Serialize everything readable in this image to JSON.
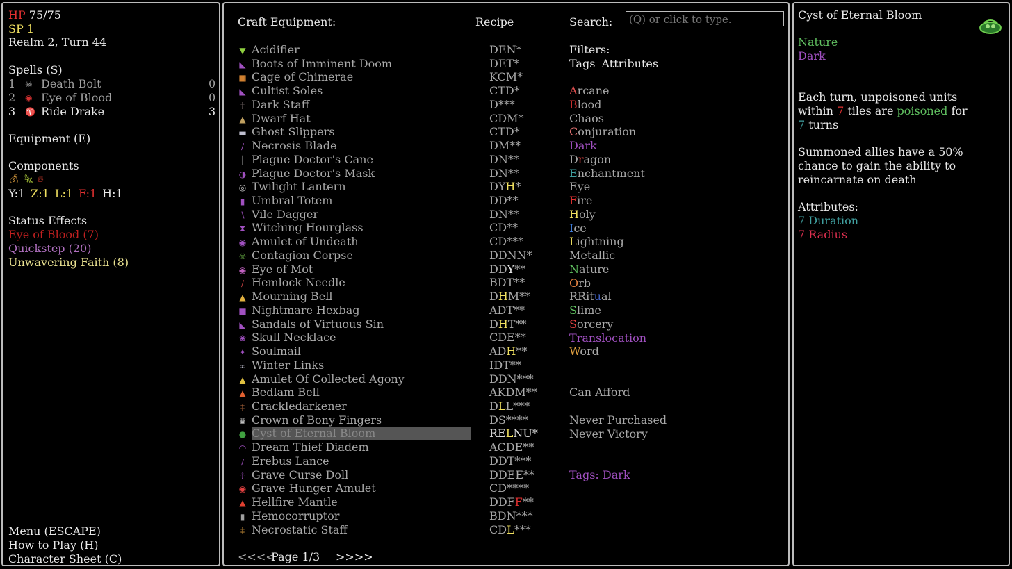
{
  "left": {
    "hp_label": "HP",
    "hp_value": "75/75",
    "sp_label": "SP",
    "sp_value": "1",
    "realm_turn": "Realm 2, Turn 44",
    "spells_header": "Spells (S)",
    "spells": [
      {
        "num": "1",
        "name": "Death Bolt",
        "charges": "0",
        "icon": "skull-bolt-icon",
        "color": "#a0a0a0"
      },
      {
        "num": "2",
        "name": "Eye of Blood",
        "charges": "0",
        "icon": "blood-eye-icon",
        "color": "#a0a0a0"
      },
      {
        "num": "3",
        "name": "Ride Drake",
        "charges": "3",
        "icon": "drake-icon",
        "color": "#e8e8e8"
      }
    ],
    "equipment_header": "Equipment (E)",
    "components_header": "Components",
    "components_counts": [
      {
        "label": "Y:1",
        "color": "#e8e8e8"
      },
      {
        "label": "Z:1",
        "color": "#f0e060"
      },
      {
        "label": "L:1",
        "color": "#f0e060"
      },
      {
        "label": "F:1",
        "color": "#e03030"
      },
      {
        "label": "H:1",
        "color": "#e8e8e8"
      }
    ],
    "status_header": "Status Effects",
    "status_effects": [
      {
        "text": "Eye of Blood (7)",
        "color": "#c02020"
      },
      {
        "text": "Quickstep (20)",
        "color": "#b070c0"
      },
      {
        "text": "Unwavering Faith (8)",
        "color": "#e8e090"
      }
    ],
    "menu": "Menu (ESCAPE)",
    "how_to_play": "How to Play (H)",
    "character_sheet": "Character Sheet (C)"
  },
  "mid": {
    "title": "Craft Equipment:",
    "recipe_header": "Recipe",
    "search_label": "Search:",
    "search_placeholder": "(Q) or click to type.",
    "items": [
      {
        "name": "Acidifier",
        "recipe": "DEN*",
        "icon": "acid-icon",
        "icolor": "#8fd040"
      },
      {
        "name": "Boots of Imminent Doom",
        "recipe": "DET*",
        "icon": "boots-icon",
        "icolor": "#a050c0"
      },
      {
        "name": "Cage of Chimerae",
        "recipe": "KCM*",
        "icon": "cage-icon",
        "icolor": "#d08030"
      },
      {
        "name": "Cultist Soles",
        "recipe": "CTD*",
        "icon": "soles-icon",
        "icolor": "#a050c0"
      },
      {
        "name": "Dark Staff",
        "recipe": "D***",
        "icon": "staff-icon",
        "icolor": "#908080"
      },
      {
        "name": "Dwarf Hat",
        "recipe": "CDM*",
        "icon": "hat-icon",
        "icolor": "#c0a060"
      },
      {
        "name": "Ghost Slippers",
        "recipe": "CTD*",
        "icon": "slippers-icon",
        "icolor": "#c0c0d0"
      },
      {
        "name": "Necrosis Blade",
        "recipe": "DM**",
        "icon": "blade-icon",
        "icolor": "#a050c0"
      },
      {
        "name": "Plague Doctor's Cane",
        "recipe": "DN**",
        "icon": "cane-icon",
        "icolor": "#a0a0a0"
      },
      {
        "name": "Plague Doctor's Mask",
        "recipe": "DN**",
        "icon": "mask-icon",
        "icolor": "#a050c0"
      },
      {
        "name": "Twilight Lantern",
        "recipe": "DYH*",
        "icon": "lantern-icon",
        "icolor": "#c0c0c0",
        "hl": {
          "ch": "H",
          "color": "#f0e060"
        }
      },
      {
        "name": "Umbral Totem",
        "recipe": "DD**",
        "icon": "totem-icon",
        "icolor": "#a050c0"
      },
      {
        "name": "Vile Dagger",
        "recipe": "DN**",
        "icon": "dagger-icon",
        "icolor": "#a050c0"
      },
      {
        "name": "Witching Hourglass",
        "recipe": "CD**",
        "icon": "hourglass-icon",
        "icolor": "#a050c0"
      },
      {
        "name": "Amulet of Undeath",
        "recipe": "CD***",
        "icon": "amulet-icon",
        "icolor": "#a050c0"
      },
      {
        "name": "Contagion Corpse",
        "recipe": "DDNN*",
        "icon": "corpse-icon",
        "icolor": "#60a040"
      },
      {
        "name": "Eye of Mot",
        "recipe": "DDY**",
        "icon": "eye-icon",
        "icolor": "#c060c0",
        "hl": {
          "ch": "Y",
          "color": "#e8e8e8"
        }
      },
      {
        "name": "Hemlock Needle",
        "recipe": "BDT**",
        "icon": "needle-icon",
        "icolor": "#c04040"
      },
      {
        "name": "Mourning Bell",
        "recipe": "DHM**",
        "icon": "bell-icon",
        "icolor": "#e0b040",
        "hl": {
          "ch": "H",
          "color": "#f0e060"
        }
      },
      {
        "name": "Nightmare Hexbag",
        "recipe": "ADT**",
        "icon": "hexbag-icon",
        "icolor": "#a050c0"
      },
      {
        "name": "Sandals of Virtuous Sin",
        "recipe": "DHT**",
        "icon": "sandals-icon",
        "icolor": "#a050c0",
        "hl": {
          "ch": "H",
          "color": "#f0e060"
        }
      },
      {
        "name": "Skull Necklace",
        "recipe": "CDE**",
        "icon": "necklace-icon",
        "icolor": "#a050c0"
      },
      {
        "name": "Soulmail",
        "recipe": "ADH**",
        "icon": "soulmail-icon",
        "icolor": "#a050c0",
        "hl": {
          "ch": "H",
          "color": "#f0e060"
        }
      },
      {
        "name": "Winter Links",
        "recipe": "IDT**",
        "icon": "links-icon",
        "icolor": "#c0c0d0"
      },
      {
        "name": "Amulet Of Collected Agony",
        "recipe": "DDN***",
        "icon": "agony-amulet-icon",
        "icolor": "#e0c040"
      },
      {
        "name": "Bedlam Bell",
        "recipe": "AKDM**",
        "icon": "bedlam-bell-icon",
        "icolor": "#e06030"
      },
      {
        "name": "Crackledarkener",
        "recipe": "DLL***",
        "icon": "crackle-icon",
        "icolor": "#c07040",
        "hl": {
          "ch": "L",
          "color": "#f0e060"
        }
      },
      {
        "name": "Crown of Bony Fingers",
        "recipe": "DS****",
        "icon": "crown-icon",
        "icolor": "#c0c0c0"
      },
      {
        "name": "Cyst of Eternal Bloom",
        "recipe": "RELNU*",
        "icon": "cyst-icon",
        "icolor": "#40a040",
        "selected": true,
        "hl": {
          "ch": "L",
          "color": "#f0e060"
        }
      },
      {
        "name": "Dream Thief Diadem",
        "recipe": "ACDE**",
        "icon": "diadem-icon",
        "icolor": "#a050c0"
      },
      {
        "name": "Erebus Lance",
        "recipe": "DDT***",
        "icon": "lance-icon",
        "icolor": "#a050c0"
      },
      {
        "name": "Grave Curse Doll",
        "recipe": "DDEE**",
        "icon": "doll-icon",
        "icolor": "#a050c0"
      },
      {
        "name": "Grave Hunger Amulet",
        "recipe": "CD****",
        "icon": "hunger-amulet-icon",
        "icolor": "#e04040"
      },
      {
        "name": "Hellfire Mantle",
        "recipe": "DDFF**",
        "icon": "mantle-icon",
        "icolor": "#e04030",
        "hl": {
          "ch": "F",
          "color": "#e03030",
          "idx": 3
        }
      },
      {
        "name": "Hemocorruptor",
        "recipe": "BDN***",
        "icon": "hemo-icon",
        "icolor": "#a0a0a0"
      },
      {
        "name": "Necrostatic Staff",
        "recipe": "CDL***",
        "icon": "necro-staff-icon",
        "icolor": "#e0a040",
        "hl": {
          "ch": "L",
          "color": "#f0e060"
        }
      }
    ],
    "filters_header": "Filters:",
    "filter_tabs": [
      "Tags",
      "Attributes"
    ],
    "tags": [
      {
        "name": "Arcane",
        "color": "#e05050"
      },
      {
        "name": "Blood",
        "color": "#d03030"
      },
      {
        "name": "Chaos",
        "color": "#a8a8a8"
      },
      {
        "name": "Conjuration",
        "color": "#e07070"
      },
      {
        "name": "Dark",
        "color": "#a050c0"
      },
      {
        "name": "Dragon",
        "color": "#e04040"
      },
      {
        "name": "Enchantment",
        "color": "#40a0a0"
      },
      {
        "name": "Eye",
        "color": "#e8e8e8"
      },
      {
        "name": "Fire",
        "color": "#e03030"
      },
      {
        "name": "Holy",
        "color": "#f0e060"
      },
      {
        "name": "Ice",
        "color": "#4080e0"
      },
      {
        "name": "Lightning",
        "color": "#f0e060"
      },
      {
        "name": "Metallic",
        "color": "#a8a8a8"
      },
      {
        "name": "Nature",
        "color": "#60c060"
      },
      {
        "name": "Orb",
        "color": "#e08040"
      },
      {
        "name": "Ritual",
        "color": "#4060c0"
      },
      {
        "name": "Slime",
        "color": "#60c060"
      },
      {
        "name": "Sorcery",
        "color": "#e04040"
      },
      {
        "name": "Translocation",
        "color": "#a050c0"
      },
      {
        "name": "Word",
        "color": "#e0a040"
      }
    ],
    "can_afford": "Can Afford",
    "never_purchased": "Never Purchased",
    "never_victory": "Never Victory",
    "tags_dark": "Tags: Dark",
    "page_prev": "<<<<",
    "page_label": "Page 1/3",
    "page_next": ">>>>"
  },
  "right": {
    "title": "Cyst of Eternal Bloom",
    "tag1": "Nature",
    "tag2": "Dark",
    "desc1": {
      "a": "Each turn, unpoisoned units",
      "b1": "within ",
      "b2": "7",
      "b3": " tiles are ",
      "b4": "poisoned",
      "b5": " for",
      "c1": "7",
      "c2": " turns"
    },
    "desc2": [
      "Summoned allies have a 50%",
      "chance to gain the ability to",
      "reincarnate on death"
    ],
    "attr_header": "Attributes:",
    "attr1": "7 Duration",
    "attr2": "7 Radius"
  }
}
